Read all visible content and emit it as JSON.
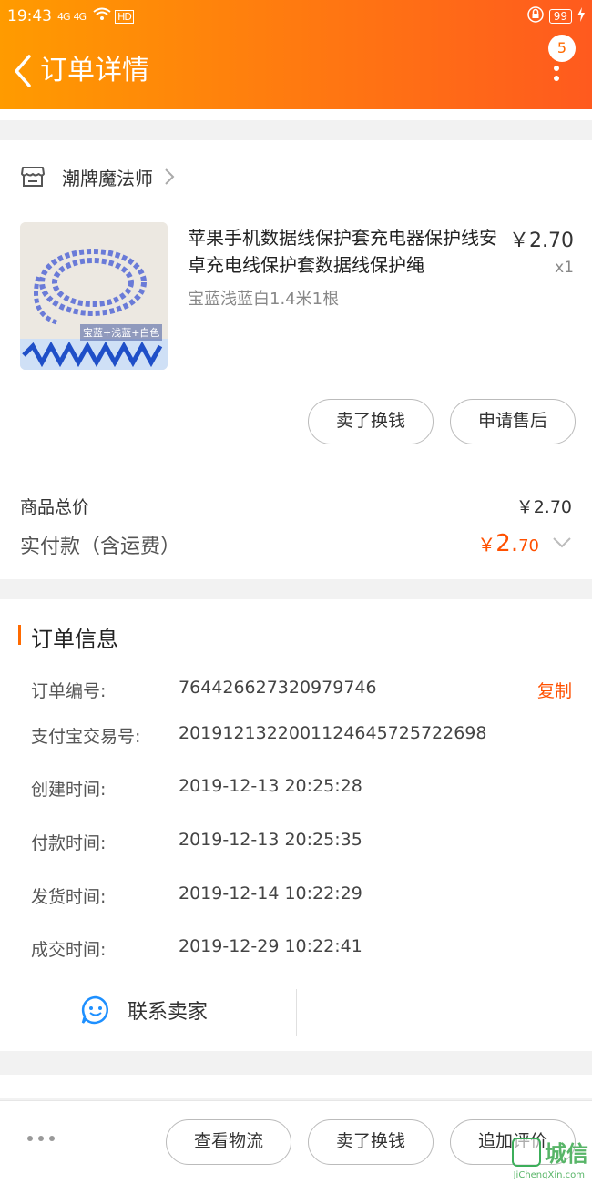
{
  "status_bar": {
    "time": "19:43",
    "signal_1": "4G",
    "signal_2": "4G",
    "hd_label": "HD",
    "battery": "99"
  },
  "header": {
    "title": "订单详情",
    "badge_count": "5"
  },
  "shop": {
    "name": "潮牌魔法师"
  },
  "product": {
    "title": "苹果手机数据线保护套充电器保护线安卓充电线保护套数据线保护绳",
    "price": "￥2.70",
    "quantity": "x1",
    "spec": "宝蓝浅蓝白1.4米1根",
    "image_caption": "宝蓝+浅蓝+白色"
  },
  "item_actions": {
    "sell_label": "卖了换钱",
    "after_sale_label": "申请售后"
  },
  "summary": {
    "total_label": "商品总价",
    "total_value": "￥2.70",
    "paid_label": "实付款（含运费）",
    "paid_currency": "￥",
    "paid_integer": "2.",
    "paid_decimal": "70"
  },
  "order_info": {
    "section_title": "订单信息",
    "copy_label": "复制",
    "rows": [
      {
        "label": "订单编号:",
        "value": "764426627320979746"
      },
      {
        "label": "支付宝交易号:",
        "value": "2019121322001124645725722698"
      },
      {
        "label": "创建时间:",
        "value": "2019-12-13 20:25:28"
      },
      {
        "label": "付款时间:",
        "value": "2019-12-13 20:25:35"
      },
      {
        "label": "发货时间:",
        "value": "2019-12-14 10:22:29"
      },
      {
        "label": "成交时间:",
        "value": "2019-12-29 10:22:41"
      }
    ],
    "contact_label": "联系卖家"
  },
  "bottom_bar": {
    "logistics_label": "查看物流",
    "sell_label": "卖了换钱",
    "review_label": "追加评价"
  },
  "watermark": {
    "text": "城信",
    "url": "JiChengXin.com"
  },
  "colors": {
    "accent": "#ff5000",
    "header_start": "#ff9b00",
    "header_end": "#ff5a1e"
  }
}
